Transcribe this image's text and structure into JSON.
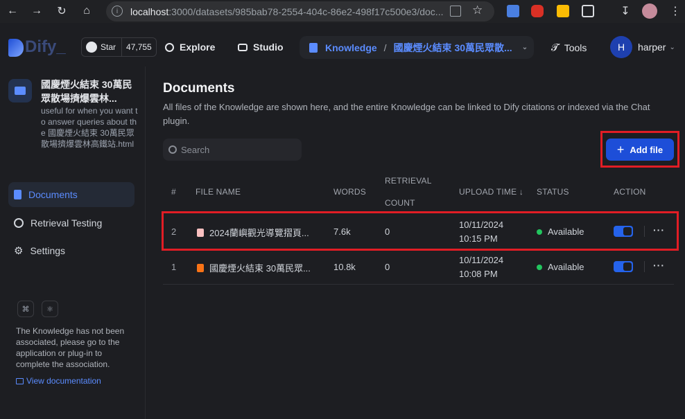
{
  "browser": {
    "url_host": "localhost",
    "url_rest": ":3000/datasets/985bab78-2554-404c-86e2-498f17c500e3/doc..."
  },
  "header": {
    "logo_text": "Dify_",
    "github": {
      "star_label": "Star",
      "star_count": "47,755"
    },
    "explore": "Explore",
    "studio": "Studio",
    "knowledge": "Knowledge",
    "separator": "/",
    "current_kb": "國慶煙火結束 30萬民眾散...",
    "tools": "Tools",
    "user": {
      "initial": "H",
      "name": "harper"
    }
  },
  "sidebar": {
    "kb_name": "國慶煙火結束 30萬民眾散場擠爆雲林...",
    "kb_desc": "useful for when you want to answer queries about the 國慶煙火結束 30萬民眾散場擠爆雲林高鐵站.html",
    "items": [
      {
        "label": "Documents",
        "active": true,
        "icon": "document-icon"
      },
      {
        "label": "Retrieval Testing",
        "active": false,
        "icon": "target-icon"
      },
      {
        "label": "Settings",
        "active": false,
        "icon": "gear-icon"
      }
    ],
    "association_text": "The Knowledge has not been associated, please go to the application or plug-in to complete the association.",
    "view_docs": "View documentation"
  },
  "main": {
    "title": "Documents",
    "description": "All files of the Knowledge are shown here, and the entire Knowledge can be linked to Dify citations or indexed via the Chat plugin.",
    "search_placeholder": "Search",
    "add_file": "Add file",
    "columns": {
      "num": "#",
      "file_name": "FILE NAME",
      "words": "WORDS",
      "retrieval_1": "RETRIEVAL",
      "retrieval_2": "COUNT",
      "upload_time": "UPLOAD TIME",
      "status": "STATUS",
      "action": "ACTION"
    },
    "rows": [
      {
        "num": "2",
        "name": "2024蘭嶼觀光導覽摺頁...",
        "words": "7.6k",
        "count": "0",
        "date": "10/11/2024",
        "time": "10:15 PM",
        "status": "Available",
        "enabled": true,
        "file_color": "#f9c0c0"
      },
      {
        "num": "1",
        "name": "國慶煙火結束 30萬民眾...",
        "words": "10.8k",
        "count": "0",
        "date": "10/11/2024",
        "time": "10:08 PM",
        "status": "Available",
        "enabled": true,
        "file_color": "#f97316"
      }
    ]
  },
  "colors": {
    "accent": "#1d4ed8",
    "link": "#5b8cff",
    "available": "#22c55e",
    "highlight": "#e11d25"
  }
}
